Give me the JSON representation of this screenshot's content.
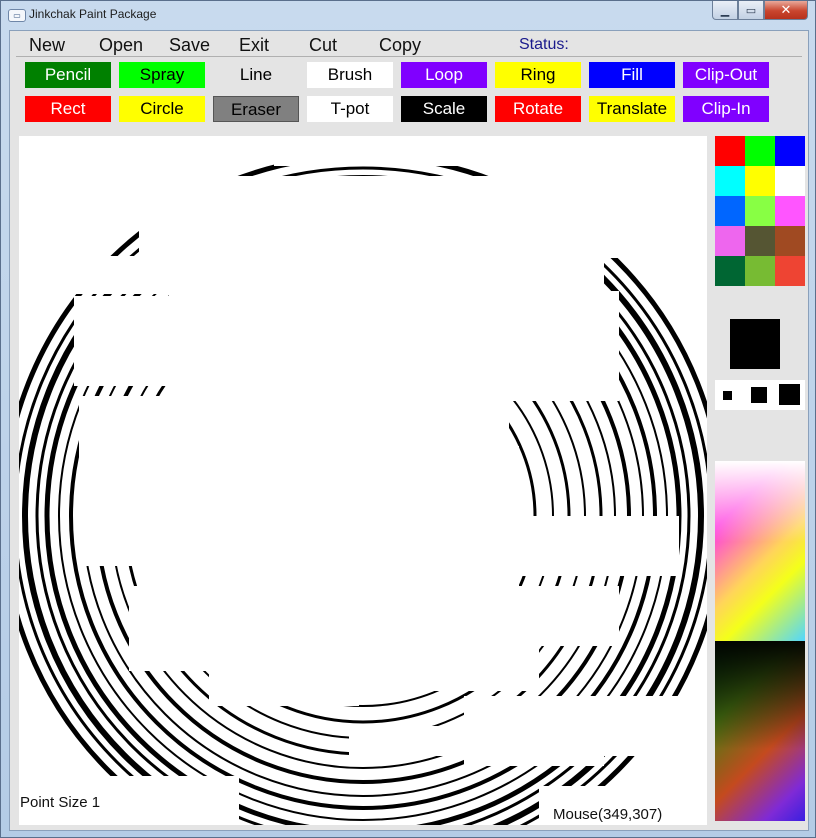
{
  "window": {
    "title": "Jinkchak Paint Package",
    "icon": "app-window-icon",
    "controls": {
      "minimize": "▁",
      "maximize": "▭",
      "close": "✕"
    }
  },
  "menu": {
    "items": [
      "New",
      "Open",
      "Save",
      "Exit",
      "Cut",
      "Copy"
    ],
    "status_label": "Status:"
  },
  "tools": [
    {
      "label": "Pencil",
      "bg": "#008000",
      "fg": "#ffffff"
    },
    {
      "label": "Spray",
      "bg": "#00ff00",
      "fg": "#000000"
    },
    {
      "label": "Line",
      "bg": "#e4e4e4",
      "fg": "#000000"
    },
    {
      "label": "Brush",
      "bg": "#ffffff",
      "fg": "#000000"
    },
    {
      "label": "Loop",
      "bg": "#8000ff",
      "fg": "#ffffff"
    },
    {
      "label": "Ring",
      "bg": "#ffff00",
      "fg": "#000000"
    },
    {
      "label": "Fill",
      "bg": "#0000ff",
      "fg": "#ffffff"
    },
    {
      "label": "Clip-Out",
      "bg": "#8000ff",
      "fg": "#ffffff"
    },
    {
      "label": "Rect",
      "bg": "#ff0000",
      "fg": "#ffffff"
    },
    {
      "label": "Circle",
      "bg": "#ffff00",
      "fg": "#000000"
    },
    {
      "label": "Eraser",
      "bg": "#808080",
      "fg": "#000000",
      "selected": true
    },
    {
      "label": "T-pot",
      "bg": "#ffffff",
      "fg": "#000000"
    },
    {
      "label": "Scale",
      "bg": "#000000",
      "fg": "#ffffff"
    },
    {
      "label": "Rotate",
      "bg": "#ff0000",
      "fg": "#ffffff"
    },
    {
      "label": "Translate",
      "bg": "#ffff00",
      "fg": "#000000"
    },
    {
      "label": "Clip-In",
      "bg": "#8000ff",
      "fg": "#ffffff"
    }
  ],
  "canvas": {
    "point_size_label": "Point Size 1",
    "mouse_label": "Mouse(349,307)"
  },
  "palette": {
    "colors": [
      "#ff0000",
      "#00ff00",
      "#0000ff",
      "#00ffff",
      "#ffff00",
      "#ffffff",
      "#0066ff",
      "#88ff44",
      "#ff55ff",
      "#ee66ee",
      "#555533",
      "#a04a22",
      "#006633",
      "#77bb33",
      "#ee4433"
    ],
    "current_color": "#000000"
  },
  "point_sizes": [
    "small",
    "medium",
    "large"
  ]
}
